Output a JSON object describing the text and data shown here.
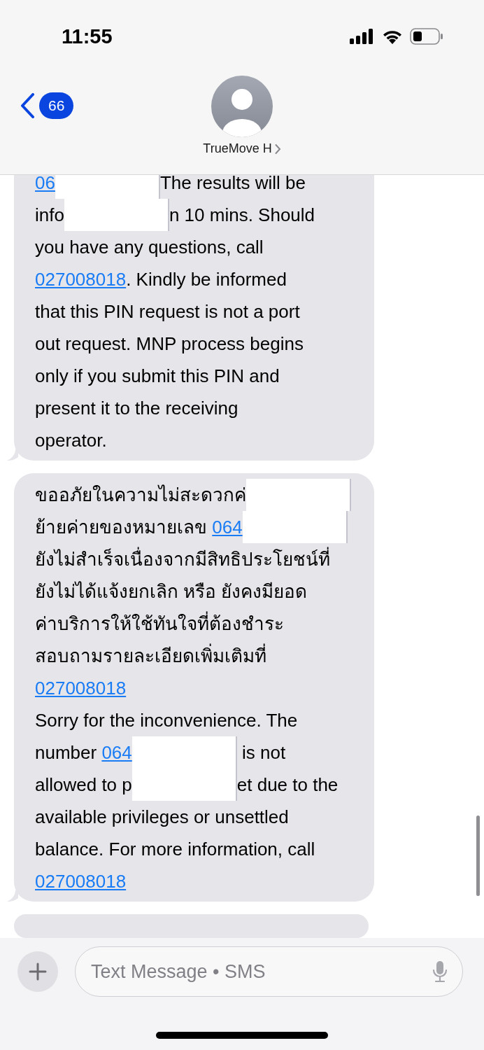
{
  "status_bar": {
    "time": "11:55"
  },
  "header": {
    "back_badge": "66",
    "contact_name": "TrueMove H"
  },
  "messages": [
    {
      "cut_off": false,
      "top_hidden": true,
      "lines": [
        [
          {
            "kind": "link",
            "text": "06"
          },
          {
            "kind": "redacted"
          },
          {
            "kind": "text",
            "text": "The results will be"
          }
        ],
        [
          {
            "kind": "text",
            "text": "info"
          },
          {
            "kind": "redacted"
          },
          {
            "kind": "text",
            "text": "n 10 mins. Should"
          }
        ],
        [
          {
            "kind": "text",
            "text": "you have any questions, call"
          }
        ],
        [
          {
            "kind": "link",
            "text": "027008018"
          },
          {
            "kind": "text",
            "text": ". Kindly be informed"
          }
        ],
        [
          {
            "kind": "text",
            "text": "that this PIN request is not a port"
          }
        ],
        [
          {
            "kind": "text",
            "text": "out request. MNP process begins"
          }
        ],
        [
          {
            "kind": "text",
            "text": "only if you submit this PIN and"
          }
        ],
        [
          {
            "kind": "text",
            "text": "present it to the receiving"
          }
        ],
        [
          {
            "kind": "text",
            "text": "operator."
          }
        ]
      ]
    },
    {
      "cut_off": false,
      "top_hidden": false,
      "lines": [
        [
          {
            "kind": "text",
            "text": "ขออภัยในความไม่สะดวกค่"
          },
          {
            "kind": "redacted"
          }
        ],
        [
          {
            "kind": "text",
            "text": "ย้ายค่ายของหมายเลข "
          },
          {
            "kind": "link",
            "text": "064"
          },
          {
            "kind": "redacted"
          }
        ],
        [
          {
            "kind": "text",
            "text": "ยังไม่สำเร็จเนื่องจากมีสิทธิประโยชน์ที่"
          }
        ],
        [
          {
            "kind": "text",
            "text": "ยังไม่ได้แจ้งยกเลิก หรือ ยังคงมียอด"
          }
        ],
        [
          {
            "kind": "text",
            "text": "ค่าบริการให้ใช้ทันใจที่ต้องชำระ"
          }
        ],
        [
          {
            "kind": "text",
            "text": "สอบถามรายละเอียดเพิ่มเติมที่"
          }
        ],
        [
          {
            "kind": "link",
            "text": "027008018"
          }
        ],
        [
          {
            "kind": "text",
            "text": "Sorry for the inconvenience. The"
          }
        ],
        [
          {
            "kind": "text",
            "text": "number "
          },
          {
            "kind": "link",
            "text": "064"
          },
          {
            "kind": "redacted"
          },
          {
            "kind": "text",
            "text": " is not"
          }
        ],
        [
          {
            "kind": "text",
            "text": "allowed to p"
          },
          {
            "kind": "redacted"
          },
          {
            "kind": "text",
            "text": "et due to the"
          }
        ],
        [
          {
            "kind": "text",
            "text": "available privileges or unsettled"
          }
        ],
        [
          {
            "kind": "text",
            "text": "balance. For more information, call"
          }
        ],
        [
          {
            "kind": "link",
            "text": "027008018"
          }
        ]
      ]
    },
    {
      "cut_off": true,
      "top_hidden": false
    }
  ],
  "composer": {
    "placeholder": "Text Message • SMS"
  }
}
